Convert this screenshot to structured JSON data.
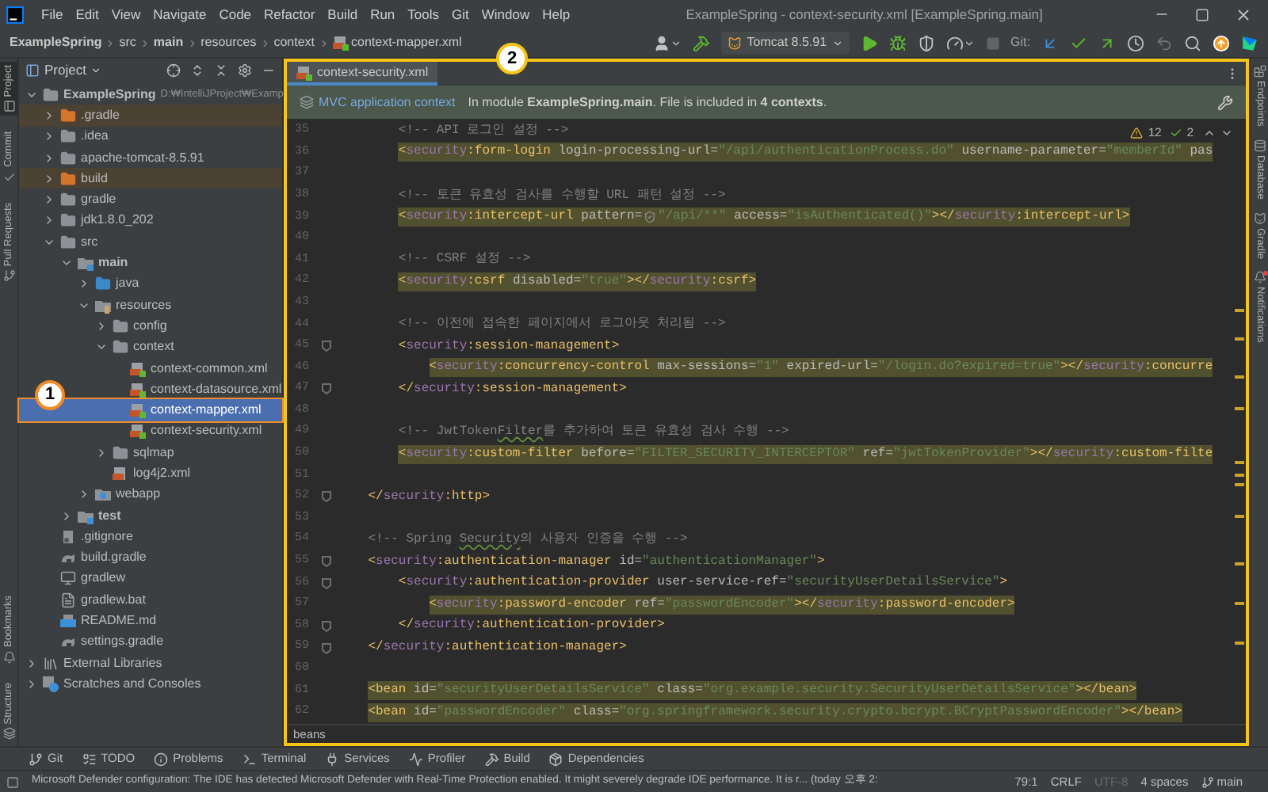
{
  "window": {
    "title": "ExampleSpring - context-security.xml [ExampleSpring.main]",
    "menu": [
      "File",
      "Edit",
      "View",
      "Navigate",
      "Code",
      "Refactor",
      "Build",
      "Run",
      "Tools",
      "Git",
      "Window",
      "Help"
    ]
  },
  "breadcrumbs": [
    {
      "text": "ExampleSpring",
      "bold": true,
      "kind": "dir"
    },
    {
      "text": "src",
      "bold": false,
      "kind": "dir"
    },
    {
      "text": "main",
      "bold": true,
      "kind": "dir"
    },
    {
      "text": "resources",
      "bold": false,
      "kind": "dir"
    },
    {
      "text": "context",
      "bold": false,
      "kind": "dir"
    },
    {
      "text": "context-mapper.xml",
      "bold": false,
      "kind": "xml"
    }
  ],
  "toolbar": [
    {
      "kind": "user",
      "disabled": false
    },
    {
      "kind": "build",
      "disabled": false
    },
    {
      "kind": "run-config",
      "label": "Tomcat 8.5.91",
      "disabled": false
    },
    {
      "kind": "run",
      "disabled": false
    },
    {
      "kind": "debug",
      "disabled": false
    },
    {
      "kind": "coverage",
      "disabled": false
    },
    {
      "kind": "profile",
      "disabled": false
    },
    {
      "kind": "stop",
      "disabled": true
    },
    {
      "kind": "label",
      "label": "Git:",
      "disabled": false
    },
    {
      "kind": "git-update",
      "disabled": false
    },
    {
      "kind": "git-commit",
      "disabled": false
    },
    {
      "kind": "git-push",
      "disabled": false
    },
    {
      "kind": "history",
      "disabled": false
    },
    {
      "kind": "rollback",
      "disabled": true
    },
    {
      "kind": "search",
      "disabled": false
    },
    {
      "kind": "updates",
      "disabled": false
    },
    {
      "kind": "logo",
      "disabled": false
    }
  ],
  "left_strip": [
    {
      "label": "Project",
      "selected": true
    },
    {
      "label": "Commit",
      "selected": false
    },
    {
      "label": "Pull Requests",
      "selected": false
    },
    {
      "label": "Bookmarks",
      "selected": false
    },
    {
      "label": "Structure",
      "selected": false
    }
  ],
  "right_strip": [
    {
      "label": "Endpoints",
      "alert": false
    },
    {
      "label": "Database",
      "alert": false
    },
    {
      "label": "Gradle",
      "alert": false
    },
    {
      "label": "Notifications",
      "alert": true
    }
  ],
  "project_panel": {
    "title": "Project",
    "tree": [
      {
        "name": "ExampleSpring",
        "hint": "D:₩IntelliJProject₩Examp",
        "kind": "project",
        "expanded": true,
        "selected": false,
        "children": [
          {
            "name": ".gradle",
            "kind": "excluded-folder",
            "expanded": false,
            "selected": false
          },
          {
            "name": ".idea",
            "kind": "folder",
            "expanded": false,
            "selected": false
          },
          {
            "name": "apache-tomcat-8.5.91",
            "kind": "folder",
            "expanded": false,
            "selected": false
          },
          {
            "name": "build",
            "kind": "excluded-folder",
            "expanded": false,
            "selected": false
          },
          {
            "name": "gradle",
            "kind": "folder",
            "expanded": false,
            "selected": false
          },
          {
            "name": "jdk1.8.0_202",
            "kind": "folder",
            "expanded": false,
            "selected": false
          },
          {
            "name": "src",
            "kind": "folder",
            "expanded": true,
            "selected": false,
            "children": [
              {
                "name": "main",
                "kind": "module-folder",
                "expanded": true,
                "selected": false,
                "children": [
                  {
                    "name": "java",
                    "kind": "source-folder",
                    "expanded": false,
                    "selected": false
                  },
                  {
                    "name": "resources",
                    "kind": "resource-folder",
                    "expanded": true,
                    "selected": false,
                    "children": [
                      {
                        "name": "config",
                        "kind": "folder",
                        "expanded": false,
                        "selected": false
                      },
                      {
                        "name": "context",
                        "kind": "folder",
                        "expanded": true,
                        "selected": false,
                        "children": [
                          {
                            "name": "context-common.xml",
                            "kind": "spring-xml",
                            "selected": false
                          },
                          {
                            "name": "context-datasource.xml",
                            "kind": "spring-xml",
                            "selected": false
                          },
                          {
                            "name": "context-mapper.xml",
                            "kind": "spring-xml",
                            "selected": true
                          },
                          {
                            "name": "context-security.xml",
                            "kind": "spring-xml",
                            "selected": false
                          }
                        ]
                      },
                      {
                        "name": "sqlmap",
                        "kind": "folder",
                        "expanded": false,
                        "selected": false
                      },
                      {
                        "name": "log4j2.xml",
                        "kind": "xml",
                        "selected": false
                      }
                    ]
                  },
                  {
                    "name": "webapp",
                    "kind": "web-folder",
                    "expanded": false,
                    "selected": false
                  }
                ]
              },
              {
                "name": "test",
                "kind": "module-folder",
                "expanded": false,
                "selected": false
              }
            ]
          },
          {
            "name": ".gitignore",
            "kind": "gitignore",
            "selected": false
          },
          {
            "name": "build.gradle",
            "kind": "gradle",
            "selected": false
          },
          {
            "name": "gradlew",
            "kind": "script",
            "selected": false
          },
          {
            "name": "gradlew.bat",
            "kind": "text",
            "selected": false
          },
          {
            "name": "README.md",
            "kind": "markdown",
            "selected": false
          },
          {
            "name": "settings.gradle",
            "kind": "gradle",
            "selected": false
          }
        ]
      },
      {
        "name": "External Libraries",
        "kind": "library",
        "expanded": false,
        "selected": false
      },
      {
        "name": "Scratches and Consoles",
        "kind": "scratches",
        "expanded": false,
        "selected": false
      }
    ]
  },
  "editor": {
    "tab": {
      "label": "context-security.xml",
      "selected": true
    },
    "info_bar": {
      "link": "MVC application context",
      "message": "In module **ExampleSpring.main**. File is included in **4 contexts**."
    },
    "inspections": {
      "warnings": "12",
      "weak_warnings": "2"
    },
    "lines": [
      {
        "number": "35",
        "highlight": false,
        "fold": false,
        "tokens": [
          {
            "kind": "comment",
            "text": "        <!-- API 로그인 설정 -->"
          }
        ]
      },
      {
        "number": "36",
        "highlight": true,
        "fold": false,
        "tokens": [
          {
            "kind": "tag",
            "text": "        <"
          },
          {
            "kind": "ns",
            "text": "security"
          },
          {
            "kind": "tag",
            "text": ":form-login"
          },
          {
            "kind": "attr",
            "text": " login-processing-url="
          },
          {
            "kind": "value",
            "text": "\"/api/authenticationProcess.do\""
          },
          {
            "kind": "attr",
            "text": " username-parameter="
          },
          {
            "kind": "value",
            "text": "\"memberId\""
          },
          {
            "kind": "attr",
            "text": " pas"
          }
        ]
      },
      {
        "number": "37",
        "highlight": false,
        "fold": false
      },
      {
        "number": "38",
        "highlight": false,
        "fold": false,
        "tokens": [
          {
            "kind": "comment",
            "text": "        <!-- 토큰 유효성 검사를 수행할 URL 패턴 설정 -->"
          }
        ]
      },
      {
        "number": "39",
        "highlight": true,
        "fold": false,
        "tokens": [
          {
            "kind": "tag",
            "text": "        <"
          },
          {
            "kind": "ns",
            "text": "security"
          },
          {
            "kind": "tag",
            "text": ":intercept-url"
          },
          {
            "kind": "attr",
            "text": " pattern="
          },
          {
            "kind": "shield"
          },
          {
            "kind": "value",
            "text": "\"/api/**\""
          },
          {
            "kind": "attr",
            "text": " access="
          },
          {
            "kind": "value",
            "text": "\"isAuthenticated()\""
          },
          {
            "kind": "tag",
            "text": "></"
          },
          {
            "kind": "ns",
            "text": "security"
          },
          {
            "kind": "tag",
            "text": ":intercept-url>"
          }
        ]
      },
      {
        "number": "40",
        "highlight": false,
        "fold": false
      },
      {
        "number": "41",
        "highlight": false,
        "fold": false,
        "tokens": [
          {
            "kind": "comment",
            "text": "        <!-- CSRF 설정 -->"
          }
        ]
      },
      {
        "number": "42",
        "highlight": true,
        "fold": false,
        "tokens": [
          {
            "kind": "tag",
            "text": "        <"
          },
          {
            "kind": "ns",
            "text": "security"
          },
          {
            "kind": "tag",
            "text": ":csrf"
          },
          {
            "kind": "attr",
            "text": " disabled="
          },
          {
            "kind": "value",
            "text": "\"true\""
          },
          {
            "kind": "tag",
            "text": "></"
          },
          {
            "kind": "ns",
            "text": "security"
          },
          {
            "kind": "tag",
            "text": ":csrf>"
          }
        ]
      },
      {
        "number": "43",
        "highlight": false,
        "fold": false
      },
      {
        "number": "44",
        "highlight": false,
        "fold": false,
        "tokens": [
          {
            "kind": "comment",
            "text": "        <!-- 이전에 접속한 페이지에서 로그아웃 처리됨 -->"
          }
        ]
      },
      {
        "number": "45",
        "highlight": false,
        "fold": true,
        "tokens": [
          {
            "kind": "tag",
            "text": "        <"
          },
          {
            "kind": "ns",
            "text": "security"
          },
          {
            "kind": "tag",
            "text": ":session-management>"
          }
        ]
      },
      {
        "number": "46",
        "highlight": true,
        "fold": false,
        "tokens": [
          {
            "kind": "tag",
            "text": "            <"
          },
          {
            "kind": "ns",
            "text": "security"
          },
          {
            "kind": "tag",
            "text": ":concurrency-control"
          },
          {
            "kind": "attr",
            "text": " max-sessions="
          },
          {
            "kind": "value",
            "text": "\"1\""
          },
          {
            "kind": "attr",
            "text": " expired-url="
          },
          {
            "kind": "value",
            "text": "\"/login.do?expired=true\""
          },
          {
            "kind": "tag",
            "text": "></"
          },
          {
            "kind": "ns",
            "text": "security"
          },
          {
            "kind": "tag",
            "text": ":concurre"
          }
        ]
      },
      {
        "number": "47",
        "highlight": false,
        "fold": true,
        "tokens": [
          {
            "kind": "tag",
            "text": "        </"
          },
          {
            "kind": "ns",
            "text": "security"
          },
          {
            "kind": "tag",
            "text": ":session-management>"
          }
        ]
      },
      {
        "number": "48",
        "highlight": false,
        "fold": false
      },
      {
        "number": "49",
        "highlight": false,
        "fold": false,
        "tokens": [
          {
            "kind": "comment",
            "text": "        <!-- JwtToken"
          },
          {
            "kind": "typo",
            "text": "Filter"
          },
          {
            "kind": "comment",
            "text": "를 추가하여 토큰 유효성 검사 수행 -->"
          }
        ]
      },
      {
        "number": "50",
        "highlight": true,
        "fold": false,
        "tokens": [
          {
            "kind": "tag",
            "text": "        <"
          },
          {
            "kind": "ns",
            "text": "security"
          },
          {
            "kind": "tag",
            "text": ":custom-filter"
          },
          {
            "kind": "attr",
            "text": " before="
          },
          {
            "kind": "value",
            "text": "\"FILTER_SECURITY_INTERCEPTOR\""
          },
          {
            "kind": "attr",
            "text": " ref="
          },
          {
            "kind": "value",
            "text": "\"jwtTokenProvider\""
          },
          {
            "kind": "tag",
            "text": "></"
          },
          {
            "kind": "ns",
            "text": "security"
          },
          {
            "kind": "tag",
            "text": ":custom-filte"
          }
        ]
      },
      {
        "number": "51",
        "highlight": false,
        "fold": false
      },
      {
        "number": "52",
        "highlight": false,
        "fold": true,
        "tokens": [
          {
            "kind": "tag",
            "text": "    </"
          },
          {
            "kind": "ns",
            "text": "security"
          },
          {
            "kind": "tag",
            "text": ":http>"
          }
        ]
      },
      {
        "number": "53",
        "highlight": false,
        "fold": false
      },
      {
        "number": "54",
        "highlight": false,
        "fold": false,
        "tokens": [
          {
            "kind": "comment",
            "text": "    <!-- Spring "
          },
          {
            "kind": "typo",
            "text": "Security"
          },
          {
            "kind": "comment",
            "text": "의 사용자 인증을 수행 -->"
          }
        ]
      },
      {
        "number": "55",
        "highlight": false,
        "fold": true,
        "tokens": [
          {
            "kind": "tag",
            "text": "    <"
          },
          {
            "kind": "ns",
            "text": "security"
          },
          {
            "kind": "tag",
            "text": ":authentication-manager"
          },
          {
            "kind": "attr",
            "text": " id="
          },
          {
            "kind": "value",
            "text": "\"authenticationManager\""
          },
          {
            "kind": "tag",
            "text": ">"
          }
        ]
      },
      {
        "number": "56",
        "highlight": false,
        "fold": true,
        "tokens": [
          {
            "kind": "tag",
            "text": "        <"
          },
          {
            "kind": "ns",
            "text": "security"
          },
          {
            "kind": "tag",
            "text": ":authentication-provider"
          },
          {
            "kind": "attr",
            "text": " user-service-ref="
          },
          {
            "kind": "value",
            "text": "\"securityUserDetailsService\""
          },
          {
            "kind": "tag",
            "text": ">"
          }
        ]
      },
      {
        "number": "57",
        "highlight": true,
        "fold": false,
        "tokens": [
          {
            "kind": "tag",
            "text": "            <"
          },
          {
            "kind": "ns",
            "text": "security"
          },
          {
            "kind": "tag",
            "text": ":password-encoder"
          },
          {
            "kind": "attr",
            "text": " ref="
          },
          {
            "kind": "value",
            "text": "\"passwordEncoder\""
          },
          {
            "kind": "tag",
            "text": "></"
          },
          {
            "kind": "ns",
            "text": "security"
          },
          {
            "kind": "tag",
            "text": ":password-encoder>"
          }
        ]
      },
      {
        "number": "58",
        "highlight": false,
        "fold": true,
        "tokens": [
          {
            "kind": "tag",
            "text": "        </"
          },
          {
            "kind": "ns",
            "text": "security"
          },
          {
            "kind": "tag",
            "text": ":authentication-provider>"
          }
        ]
      },
      {
        "number": "59",
        "highlight": false,
        "fold": true,
        "tokens": [
          {
            "kind": "tag",
            "text": "    </"
          },
          {
            "kind": "ns",
            "text": "security"
          },
          {
            "kind": "tag",
            "text": ":authentication-manager>"
          }
        ]
      },
      {
        "number": "60",
        "highlight": false,
        "fold": false
      },
      {
        "number": "61",
        "highlight": true,
        "fold": false,
        "tokens": [
          {
            "kind": "tag",
            "text": "    <bean"
          },
          {
            "kind": "attr",
            "text": " id="
          },
          {
            "kind": "value",
            "text": "\"securityUserDetailsService\""
          },
          {
            "kind": "attr",
            "text": " class="
          },
          {
            "kind": "value",
            "text": "\"org.example.security.SecurityUserDetailsService\""
          },
          {
            "kind": "tag",
            "text": "></bean>"
          }
        ]
      },
      {
        "number": "62",
        "highlight": true,
        "fold": false,
        "tokens": [
          {
            "kind": "tag",
            "text": "    <bean"
          },
          {
            "kind": "attr",
            "text": " id="
          },
          {
            "kind": "value",
            "text": "\"passwordEncoder\""
          },
          {
            "kind": "attr",
            "text": " class="
          },
          {
            "kind": "value",
            "text": "\"org.springframework.security.crypto.bcrypt.BCryptPasswordEncoder\""
          },
          {
            "kind": "tag",
            "text": "></bean>"
          }
        ]
      }
    ],
    "footer": "beans"
  },
  "tool_windows": [
    {
      "kind": "git",
      "label": "Git"
    },
    {
      "kind": "todo",
      "label": "TODO"
    },
    {
      "kind": "problems",
      "label": "Problems"
    },
    {
      "kind": "terminal",
      "label": "Terminal"
    },
    {
      "kind": "services",
      "label": "Services"
    },
    {
      "kind": "profiler",
      "label": "Profiler"
    },
    {
      "kind": "build",
      "label": "Build"
    },
    {
      "kind": "dependencies",
      "label": "Dependencies"
    }
  ],
  "status_bar": {
    "message": "Microsoft Defender configuration: The IDE has detected Microsoft Defender with Real-Time Protection enabled. It might severely degrade IDE performance. It is r... (today 오후 2:",
    "items": [
      {
        "text": "79:1",
        "disabled": false,
        "kind": "text"
      },
      {
        "text": "CRLF",
        "disabled": false,
        "kind": "text"
      },
      {
        "text": "UTF-8",
        "disabled": true,
        "kind": "text"
      },
      {
        "text": "4 spaces",
        "disabled": false,
        "kind": "text"
      },
      {
        "text": "main",
        "disabled": false,
        "kind": "branch"
      }
    ]
  },
  "annotations": [
    {
      "label": "1",
      "color": "#f08c28"
    },
    {
      "label": "2",
      "color": "#f5c518"
    }
  ]
}
